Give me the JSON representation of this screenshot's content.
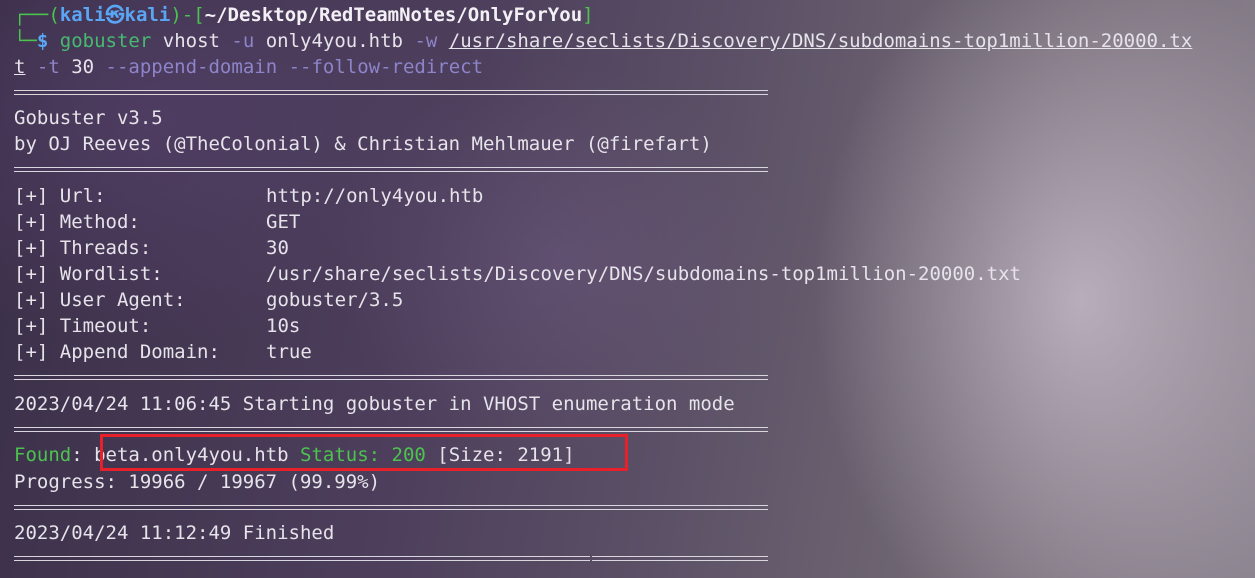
{
  "prompt": {
    "corner_top": "┌──(",
    "user": "kali",
    "at_symbol": "㉿",
    "host": "kali",
    "close_open": ")-[",
    "cwd": "~/Desktop/RedTeamNotes/OnlyForYou",
    "close_bracket": "]",
    "corner_bottom": "└─",
    "dollar": "$"
  },
  "command": {
    "program": "gobuster",
    "subcommand": " vhost ",
    "flag_u": "-u",
    "target": " only4you.htb ",
    "flag_w": "-w",
    "wordlist_line1": "/usr/share/seclists/Discovery/DNS/subdomains-top1million-20000.tx",
    "wordlist_line2": "t",
    "flag_t": " -t",
    "threads": " 30 ",
    "append_domain": "--append-domain",
    "follow_redirect": " --follow-redirect"
  },
  "banner": {
    "version": "Gobuster v3.5",
    "authors": "by OJ Reeves (@TheColonial) & Christian Mehlmauer (@firefart)"
  },
  "config": [
    {
      "key": "[+] Url:",
      "value": "http://only4you.htb"
    },
    {
      "key": "[+] Method:",
      "value": "GET"
    },
    {
      "key": "[+] Threads:",
      "value": "30"
    },
    {
      "key": "[+] Wordlist:",
      "value": "/usr/share/seclists/Discovery/DNS/subdomains-top1million-20000.txt"
    },
    {
      "key": "[+] User Agent:",
      "value": "gobuster/3.5"
    },
    {
      "key": "[+] Timeout:",
      "value": "10s"
    },
    {
      "key": "[+] Append Domain:",
      "value": "true"
    }
  ],
  "start_line": "2023/04/24 11:06:45 Starting gobuster in VHOST enumeration mode",
  "result": {
    "found_label": "Found",
    "colon": ": ",
    "host": "beta.only4you.htb",
    "status_label": " Status: 200",
    "size": " [Size: 2191]"
  },
  "progress": "Progress: 19966 / 19967 (99.99%)",
  "finished_line": "2023/04/24 11:12:49 Finished",
  "colors": {
    "prompt_blue": "#5aa6f5",
    "found_green": "#4cc34e",
    "highlight_red": "#e8202a"
  }
}
